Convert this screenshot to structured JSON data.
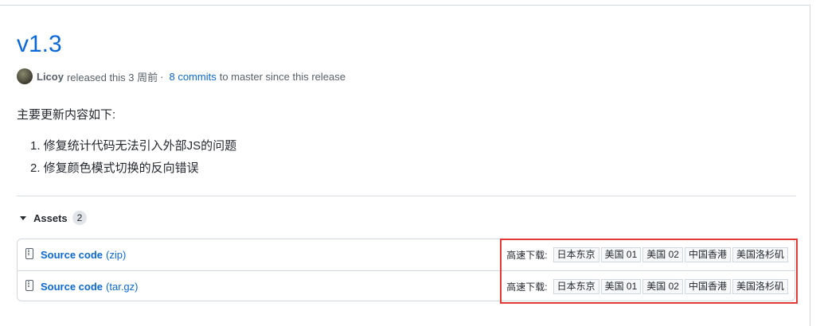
{
  "release": {
    "title": "v1.3",
    "author": "Licoy",
    "released_text": "released this 3 周前",
    "separator": "·",
    "commits_link": "8 commits",
    "commits_suffix": "to master since this release"
  },
  "notes": {
    "intro": "主要更新内容如下:",
    "items": [
      "1. 修复统计代码无法引入外部JS的问题",
      "2. 修复颜色模式切换的反向错误"
    ]
  },
  "assets": {
    "label": "Assets",
    "count": "2",
    "rows": [
      {
        "name": "Source code",
        "ext": "(zip)"
      },
      {
        "name": "Source code",
        "ext": "(tar.gz)"
      }
    ],
    "mirror_label": "高速下载:",
    "mirrors": [
      "日本东京",
      "美国 01",
      "美国 02",
      "中国香港",
      "美国洛杉矶"
    ]
  },
  "colors": {
    "link": "#0969da",
    "highlight": "#e53935"
  },
  "icons": {
    "asset": "file-zip-icon",
    "toggle": "triangle-down-icon"
  }
}
